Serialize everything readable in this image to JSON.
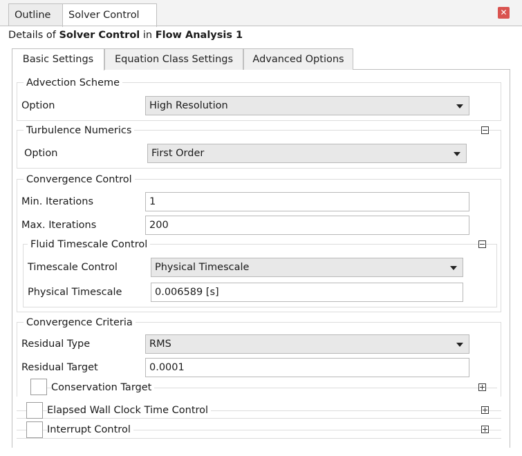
{
  "tabs": {
    "outline": "Outline",
    "solver_control": "Solver Control"
  },
  "details": {
    "prefix": "Details of",
    "object": "Solver Control",
    "in": "in",
    "parent": "Flow Analysis 1"
  },
  "inner_tabs": {
    "basic": "Basic Settings",
    "equation": "Equation Class Settings",
    "advanced": "Advanced Options"
  },
  "advection": {
    "title": "Advection Scheme",
    "option_label": "Option",
    "option_value": "High Resolution"
  },
  "turbulence": {
    "title": "Turbulence Numerics",
    "option_label": "Option",
    "option_value": "First Order"
  },
  "convergence_control": {
    "title": "Convergence Control",
    "min_label": "Min. Iterations",
    "min_value": "1",
    "max_label": "Max. Iterations",
    "max_value": "200",
    "fluid": {
      "title": "Fluid Timescale Control",
      "tc_label": "Timescale Control",
      "tc_value": "Physical Timescale",
      "pt_label": "Physical Timescale",
      "pt_value": "0.006589 [s]"
    }
  },
  "criteria": {
    "title": "Convergence Criteria",
    "type_label": "Residual Type",
    "type_value": "RMS",
    "target_label": "Residual Target",
    "target_value": "0.0001",
    "conservation_label": "Conservation Target"
  },
  "elapsed": {
    "label": "Elapsed Wall Clock Time Control"
  },
  "interrupt": {
    "label": "Interrupt Control"
  },
  "colors": {
    "close": "#d9534f",
    "border": "#bfbfbf"
  }
}
